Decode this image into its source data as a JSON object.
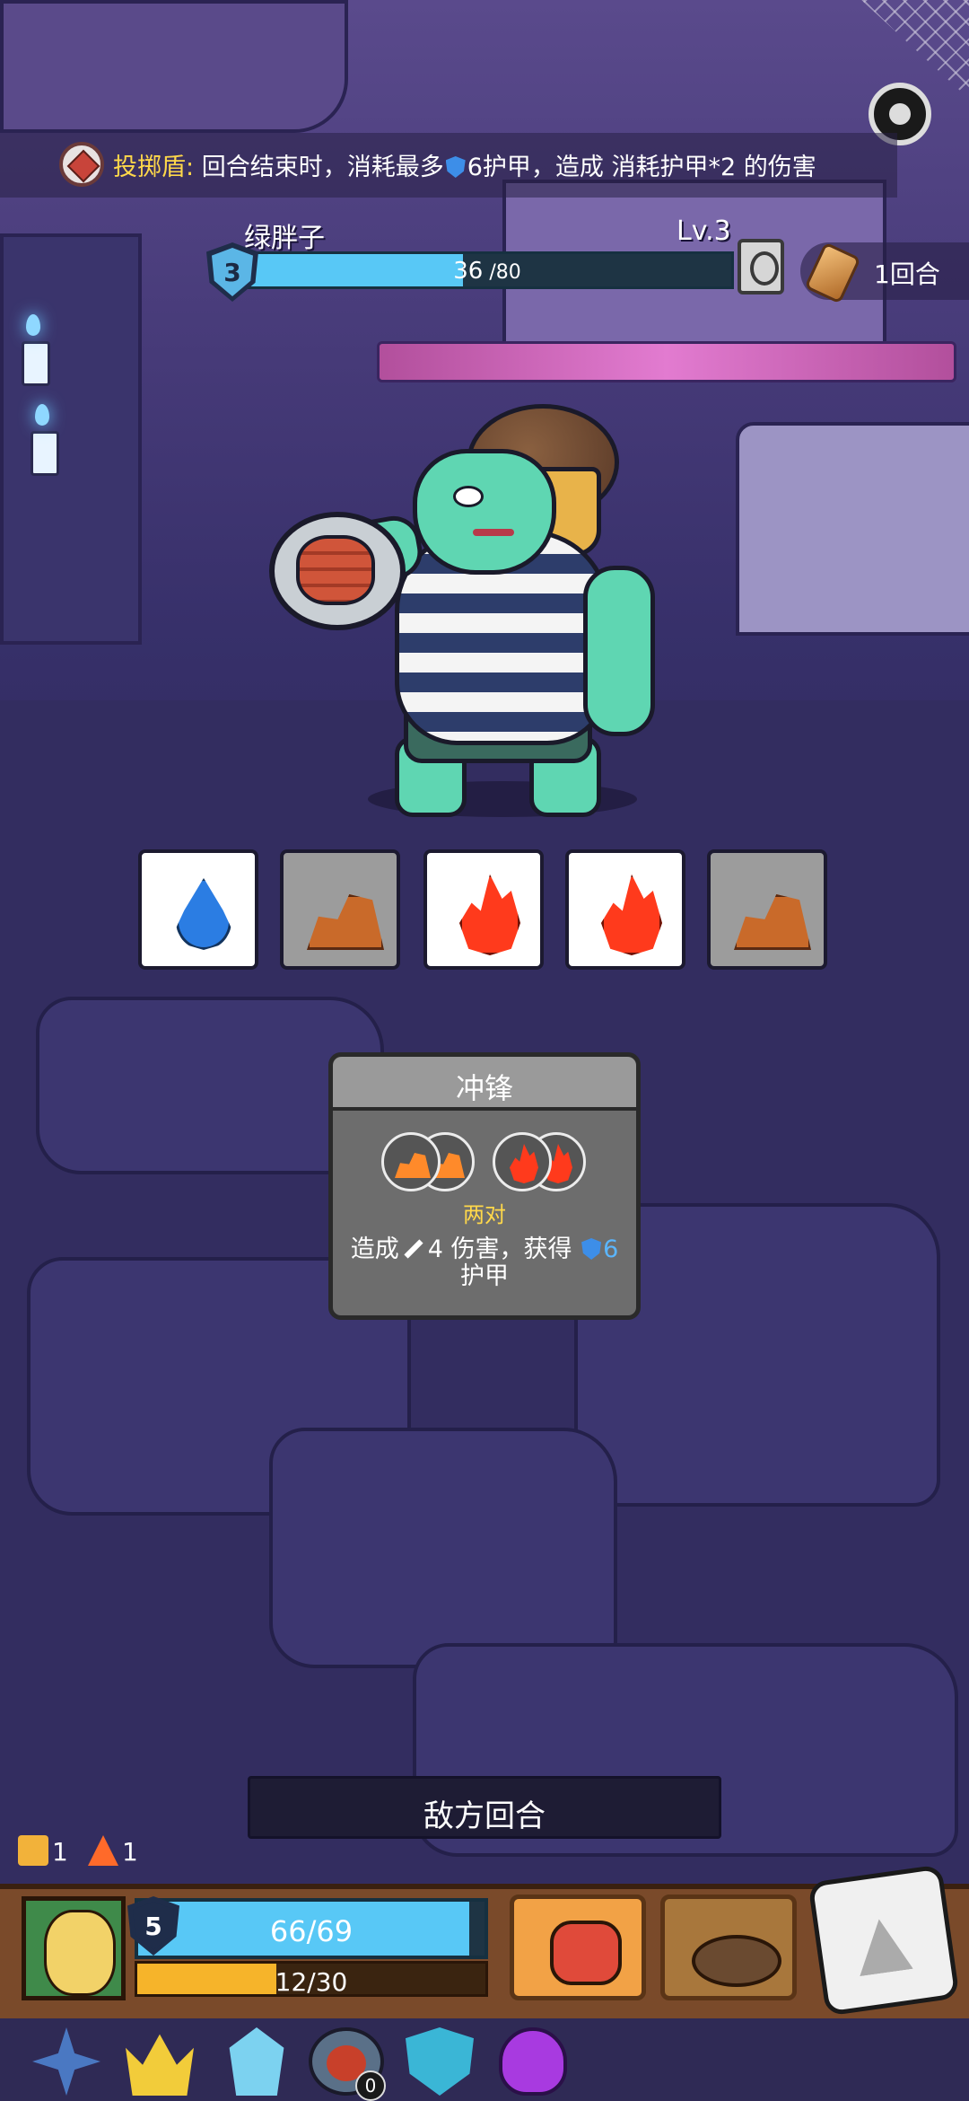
{
  "top_banner": {
    "ability_name": "投掷盾",
    "sep": ":",
    "desc_before": " 回合结束时，消耗最多",
    "desc_value": "6",
    "desc_after": "护甲，造成 消耗护甲*2 的伤害"
  },
  "enemy": {
    "name": "绿胖子",
    "level": "Lv.3",
    "armor": "3",
    "hp": "36",
    "hp_max": " /80",
    "hp_fraction": 0.45,
    "rounds": "1回合"
  },
  "dice": [
    {
      "type": "water",
      "color": "white"
    },
    {
      "type": "earth",
      "color": "grey"
    },
    {
      "type": "fire",
      "color": "white"
    },
    {
      "type": "fire",
      "color": "white"
    },
    {
      "type": "earth",
      "color": "grey"
    }
  ],
  "intent_card": {
    "title": "冲锋",
    "condition": "两对",
    "desc_prefix": "造成",
    "damage": "4",
    "desc_mid": " 伤害，获得",
    "armor_gain": "6",
    "desc_suffix": "护甲"
  },
  "turn_banner": "敌方回合",
  "counters": {
    "crate": "1",
    "flame": "1"
  },
  "player": {
    "armor": "5",
    "hp_text": "66/69",
    "hp_fraction": 0.957,
    "xp_text": "12/30",
    "xp_fraction": 0.4
  },
  "items": {
    "plate_count": "0"
  },
  "icons": {
    "gear": "settings-gear-icon",
    "scroll": "scroll-icon",
    "intent": "enemy-intent-icon"
  },
  "colors": {
    "hp_bar": "#58c8f6",
    "xp_bar": "#f6b42a",
    "banner_title": "#ffd84a"
  }
}
